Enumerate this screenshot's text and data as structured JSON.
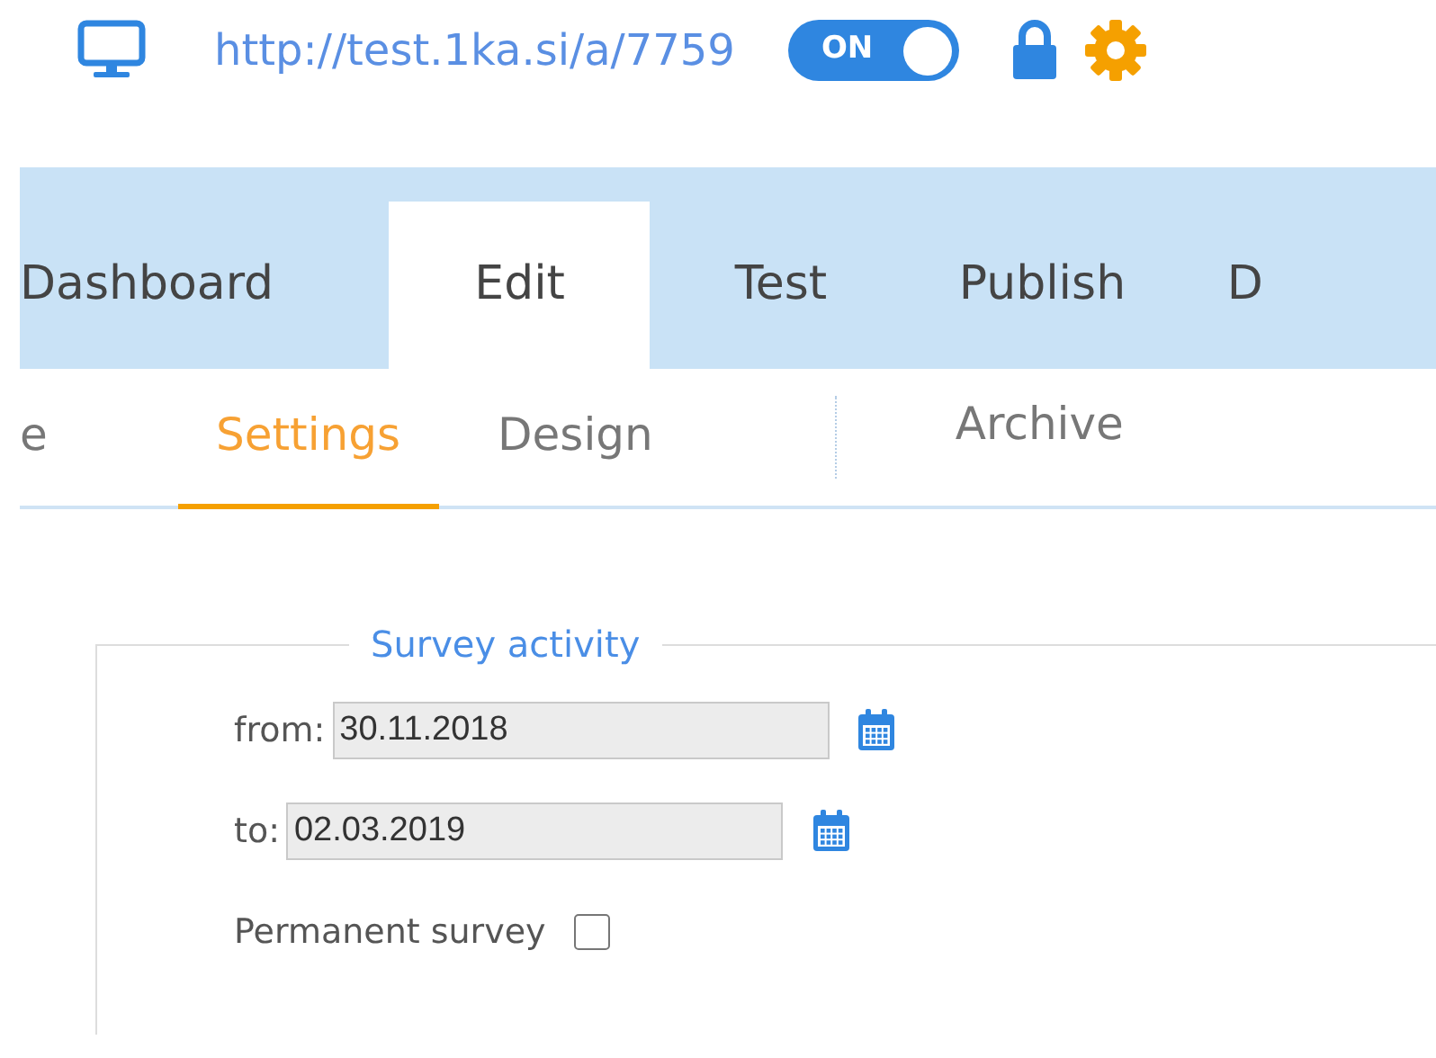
{
  "top_bar": {
    "url": "http://test.1ka.si/a/7759",
    "toggle": {
      "label": "ON",
      "on": true
    }
  },
  "main_tabs": [
    {
      "label": "Dashboard",
      "selected": false
    },
    {
      "label": "Edit",
      "selected": true
    },
    {
      "label": "Test",
      "selected": false
    },
    {
      "label": "Publish",
      "selected": false
    },
    {
      "label": "D",
      "selected": false
    }
  ],
  "sub_tabs": [
    {
      "label": "e",
      "selected": false
    },
    {
      "label": "Settings",
      "selected": true
    },
    {
      "label": "Design",
      "selected": false
    },
    {
      "label": "Archive",
      "selected": false
    }
  ],
  "survey_activity": {
    "legend": "Survey activity",
    "from": {
      "label": "from:",
      "value": "30.11.2018"
    },
    "to": {
      "label": "to:",
      "value": "02.03.2019"
    },
    "permanent": {
      "label": "Permanent survey",
      "checked": false
    }
  }
}
